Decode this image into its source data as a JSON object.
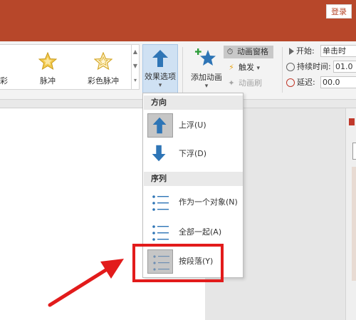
{
  "titlebar": {
    "login_label": "登录",
    "bg_color": "#b7472a"
  },
  "gallery": {
    "partial_label": "彩",
    "items": [
      {
        "label": "脉冲",
        "icon": "star-pulse-icon"
      },
      {
        "label": "彩色脉冲",
        "icon": "star-color-pulse-icon"
      }
    ]
  },
  "ribbon": {
    "effect_options": {
      "label": "效果选项",
      "icon": "arrow-up-icon",
      "caret": "▾"
    },
    "add_animation": {
      "label": "添加动画",
      "icon": "add-animation-star-icon",
      "caret": "▾"
    },
    "animation_pane": {
      "label": "动画窗格",
      "icon": "animation-pane-icon"
    },
    "trigger": {
      "label": "触发",
      "icon": "lightning-icon",
      "caret": "▾"
    },
    "animation_painter": {
      "label": "动画刷",
      "icon": "brush-icon"
    },
    "timing": {
      "start_label": "开始:",
      "start_value": "单击时",
      "duration_label": "持续时间:",
      "duration_value": "01.0",
      "delay_label": "延迟:",
      "delay_value": "00.0"
    }
  },
  "dropdown": {
    "direction_header": "方向",
    "sequence_header": "序列",
    "direction_items": [
      {
        "label": "上浮(U)",
        "icon": "arrow-up-icon",
        "selected": true
      },
      {
        "label": "下浮(D)",
        "icon": "arrow-down-icon",
        "selected": false
      }
    ],
    "sequence_items": [
      {
        "label": "作为一个对象(N)",
        "icon": "as-one-object-icon",
        "selected": false
      },
      {
        "label": "全部一起(A)",
        "icon": "all-at-once-icon",
        "selected": false
      },
      {
        "label": "按段落(Y)",
        "icon": "by-paragraph-icon",
        "selected": true
      }
    ]
  },
  "colors": {
    "accent_blue": "#2e75b6",
    "highlight_red": "#e21b1b",
    "selected_bg": "#c6c6c6"
  }
}
